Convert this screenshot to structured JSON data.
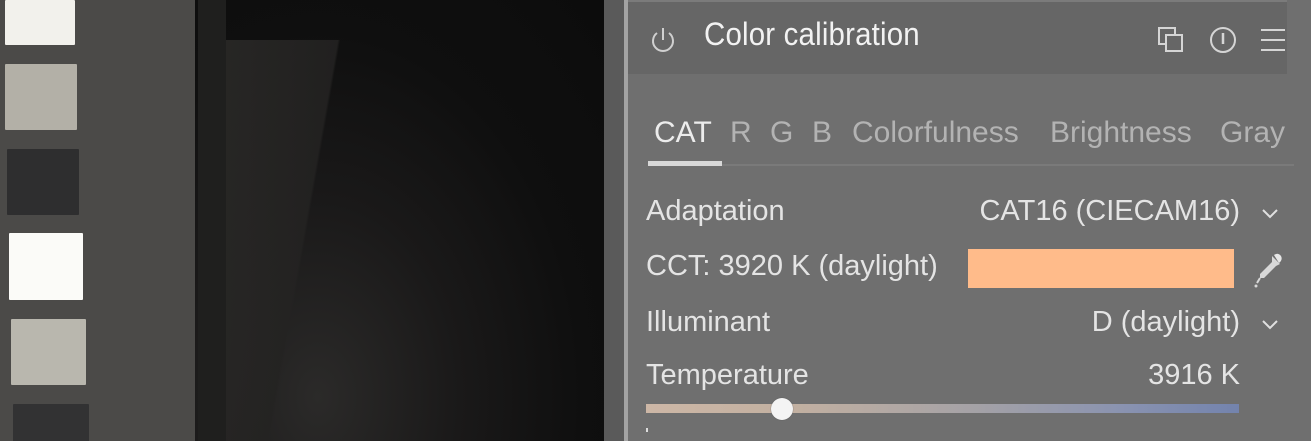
{
  "module": {
    "title": "Color calibration"
  },
  "tabs": [
    {
      "label": "CAT",
      "active": true
    },
    {
      "label": "R",
      "active": false
    },
    {
      "label": "G",
      "active": false
    },
    {
      "label": "B",
      "active": false
    },
    {
      "label": "Colorfulness",
      "active": false
    },
    {
      "label": "Brightness",
      "active": false
    },
    {
      "label": "Gray",
      "active": false
    }
  ],
  "adaptation": {
    "label": "Adaptation",
    "value": "CAT16 (CIECAM16)"
  },
  "cct": {
    "label": "CCT: 3920 K (daylight)",
    "swatch_color": "#ffbb8a"
  },
  "illuminant": {
    "label": "Illuminant",
    "value": "D (daylight)"
  },
  "temperature": {
    "label": "Temperature",
    "value": "3916 K",
    "slider_fraction": 0.23
  },
  "colors": {
    "panel_bg": "#6f6f6f",
    "header_bg": "#666666",
    "text": "#e4e4e4",
    "tab_inactive": "#b3b3b3"
  },
  "icons": [
    "power-icon",
    "multi-instance-icon",
    "reset-icon",
    "presets-menu-icon",
    "chevron-down-icon",
    "color-picker-icon"
  ]
}
